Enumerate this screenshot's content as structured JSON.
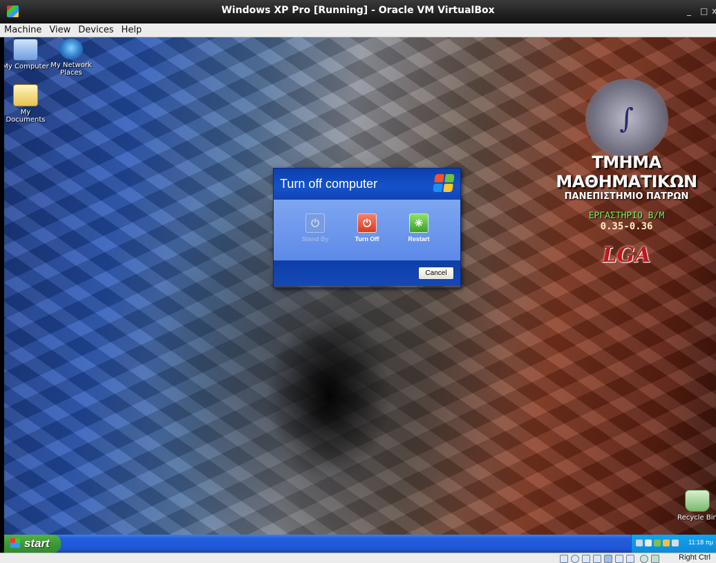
{
  "window": {
    "title": "Windows XP Pro [Running] - Oracle VM VirtualBox",
    "controls": [
      "_",
      "□",
      "x"
    ]
  },
  "menubar": {
    "items": [
      "Machine",
      "View",
      "Devices",
      "Help"
    ]
  },
  "desktop": {
    "icons": [
      {
        "label": "My Computer",
        "icon": "my-computer-icon"
      },
      {
        "label": "My Network Places",
        "icon": "network-places-icon"
      },
      {
        "label": "My Documents",
        "icon": "my-documents-icon"
      },
      {
        "label": "Recycle Bin",
        "icon": "recycle-bin-icon"
      }
    ],
    "wallpaper": {
      "department": "ΤΜΗΜΑ ΜΑΘΗΜΑΤΙΚΩΝ",
      "university": "ΠΑΝΕΠΙΣΤΗΜΙΟ ΠΑΤΡΩΝ",
      "lab": "ΕΡΓΑΣΤΗΡΙΟ Β/Μ",
      "rooms": "0.35-0.36",
      "logo_text": "LGA"
    }
  },
  "dialog": {
    "title": "Turn off computer",
    "options": [
      {
        "label": "Stand By",
        "icon": "power-standby-icon",
        "enabled": false
      },
      {
        "label": "Turn Off",
        "icon": "power-off-icon",
        "enabled": true
      },
      {
        "label": "Restart",
        "icon": "restart-icon",
        "enabled": true
      }
    ],
    "cancel_label": "Cancel"
  },
  "taskbar": {
    "start_label": "start",
    "clock": "11:18 πμ"
  },
  "statusbar": {
    "host_key": "Right Ctrl"
  },
  "colors": {
    "xp_blue": "#245edb",
    "start_green": "#3d9a36",
    "turn_off_red": "#d93b20",
    "restart_green": "#3aa02a"
  }
}
